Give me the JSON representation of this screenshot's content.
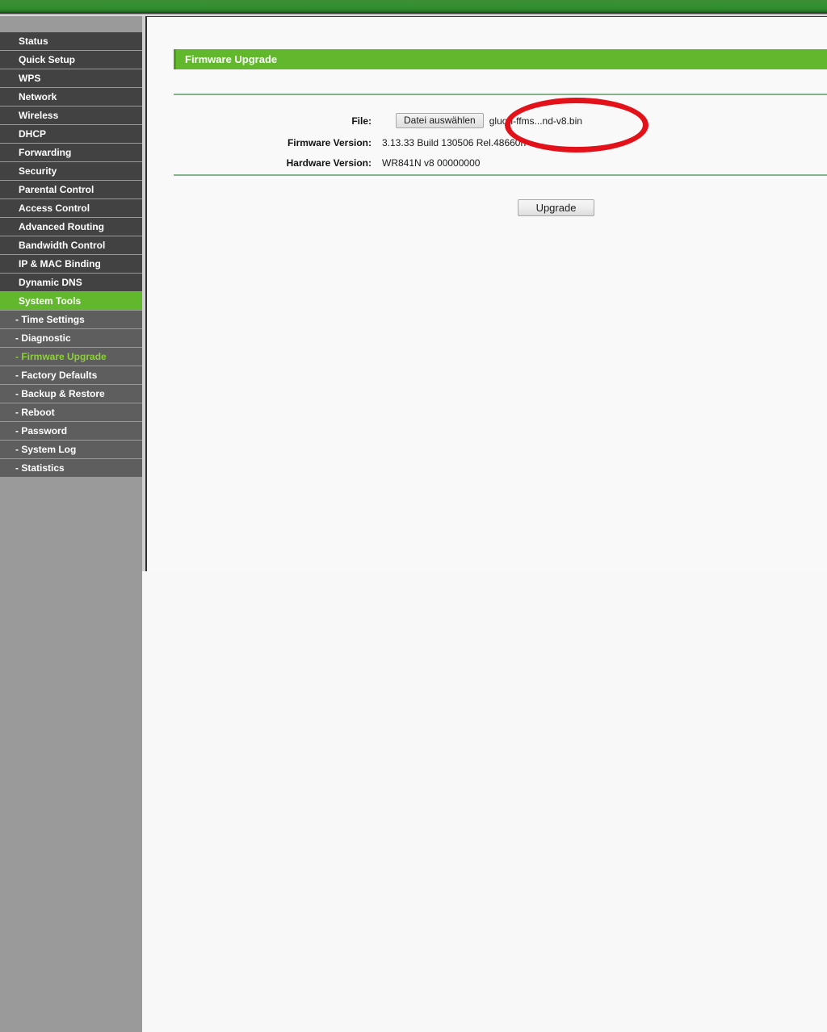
{
  "browser_chrome": {
    "accent_green": "#349031"
  },
  "sidebar": {
    "items": [
      {
        "label": "Status",
        "type": "top",
        "state": "normal"
      },
      {
        "label": "Quick Setup",
        "type": "top",
        "state": "normal"
      },
      {
        "label": "WPS",
        "type": "top",
        "state": "normal"
      },
      {
        "label": "Network",
        "type": "top",
        "state": "normal"
      },
      {
        "label": "Wireless",
        "type": "top",
        "state": "normal"
      },
      {
        "label": "DHCP",
        "type": "top",
        "state": "normal"
      },
      {
        "label": "Forwarding",
        "type": "top",
        "state": "normal"
      },
      {
        "label": "Security",
        "type": "top",
        "state": "normal"
      },
      {
        "label": "Parental Control",
        "type": "top",
        "state": "normal"
      },
      {
        "label": "Access Control",
        "type": "top",
        "state": "normal"
      },
      {
        "label": "Advanced Routing",
        "type": "top",
        "state": "normal"
      },
      {
        "label": "Bandwidth Control",
        "type": "top",
        "state": "normal"
      },
      {
        "label": "IP & MAC Binding",
        "type": "top",
        "state": "normal"
      },
      {
        "label": "Dynamic DNS",
        "type": "top",
        "state": "normal"
      },
      {
        "label": "System Tools",
        "type": "top",
        "state": "active-parent"
      },
      {
        "label": "- Time Settings",
        "type": "sub",
        "state": "normal"
      },
      {
        "label": "- Diagnostic",
        "type": "sub",
        "state": "normal"
      },
      {
        "label": "- Firmware Upgrade",
        "type": "sub",
        "state": "active-sub"
      },
      {
        "label": "- Factory Defaults",
        "type": "sub",
        "state": "normal"
      },
      {
        "label": "- Backup & Restore",
        "type": "sub",
        "state": "normal"
      },
      {
        "label": "- Reboot",
        "type": "sub",
        "state": "normal"
      },
      {
        "label": "- Password",
        "type": "sub",
        "state": "normal"
      },
      {
        "label": "- System Log",
        "type": "sub",
        "state": "normal"
      },
      {
        "label": "- Statistics",
        "type": "sub",
        "state": "normal"
      }
    ],
    "active_color": "#62b82c",
    "active_sub_text_color": "#8ed03c"
  },
  "main": {
    "section_title": "Firmware Upgrade",
    "section_title_bg": "#62b82c",
    "rows": {
      "file": {
        "label": "File:",
        "button_label": "Datei auswählen",
        "file_name": "gluon-ffms...nd-v8.bin"
      },
      "firmware": {
        "label": "Firmware Version:",
        "value": "3.13.33 Build 130506 Rel.48660n"
      },
      "hardware": {
        "label": "Hardware Version:",
        "value": "WR841N v8 00000000"
      }
    },
    "upgrade_button": "Upgrade"
  },
  "annotation": {
    "shape": "ellipse",
    "color": "#e3121a",
    "targets": "file-row"
  }
}
